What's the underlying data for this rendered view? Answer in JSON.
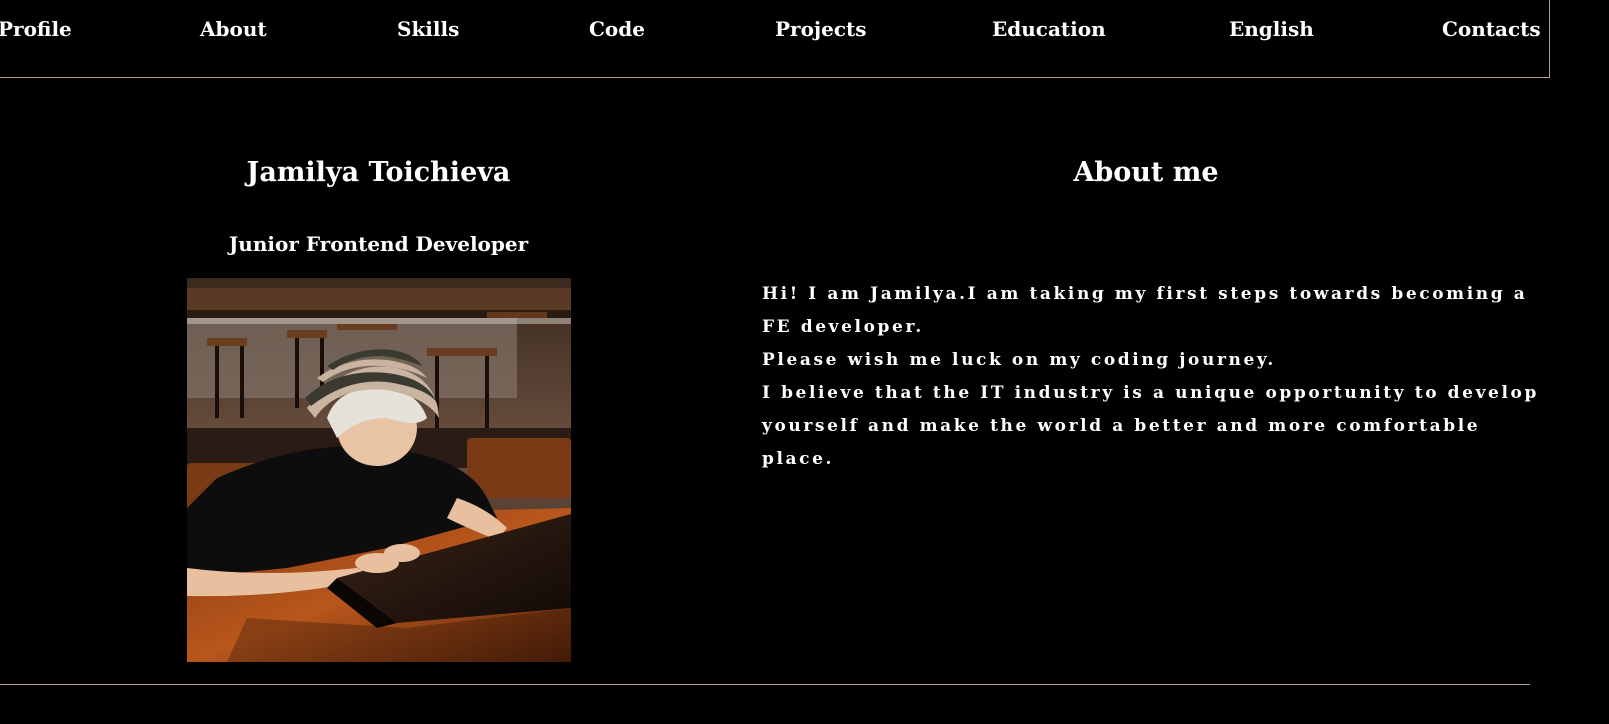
{
  "nav": {
    "items": [
      {
        "label": "Profile"
      },
      {
        "label": "About"
      },
      {
        "label": "Skills"
      },
      {
        "label": "Code"
      },
      {
        "label": "Projects"
      },
      {
        "label": "Education"
      },
      {
        "label": "English"
      },
      {
        "label": "Contacts"
      }
    ]
  },
  "profile": {
    "name": "Jamilya Toichieva",
    "role": "Junior Frontend Developer",
    "photo_icon": "profile-photo-girl-with-laptop"
  },
  "about": {
    "title": "About me",
    "paragraphs": [
      "Hi! I am Jamilya.I am taking my first steps towards becoming a FE developer.",
      "Please wish me luck on my coding journey.",
      "I believe that the IT industry is a unique opportunity to develop yourself and make the world a better and more comfortable place."
    ]
  },
  "colors": {
    "background": "#000000",
    "text": "#ffffff",
    "border": "#b39a84"
  }
}
